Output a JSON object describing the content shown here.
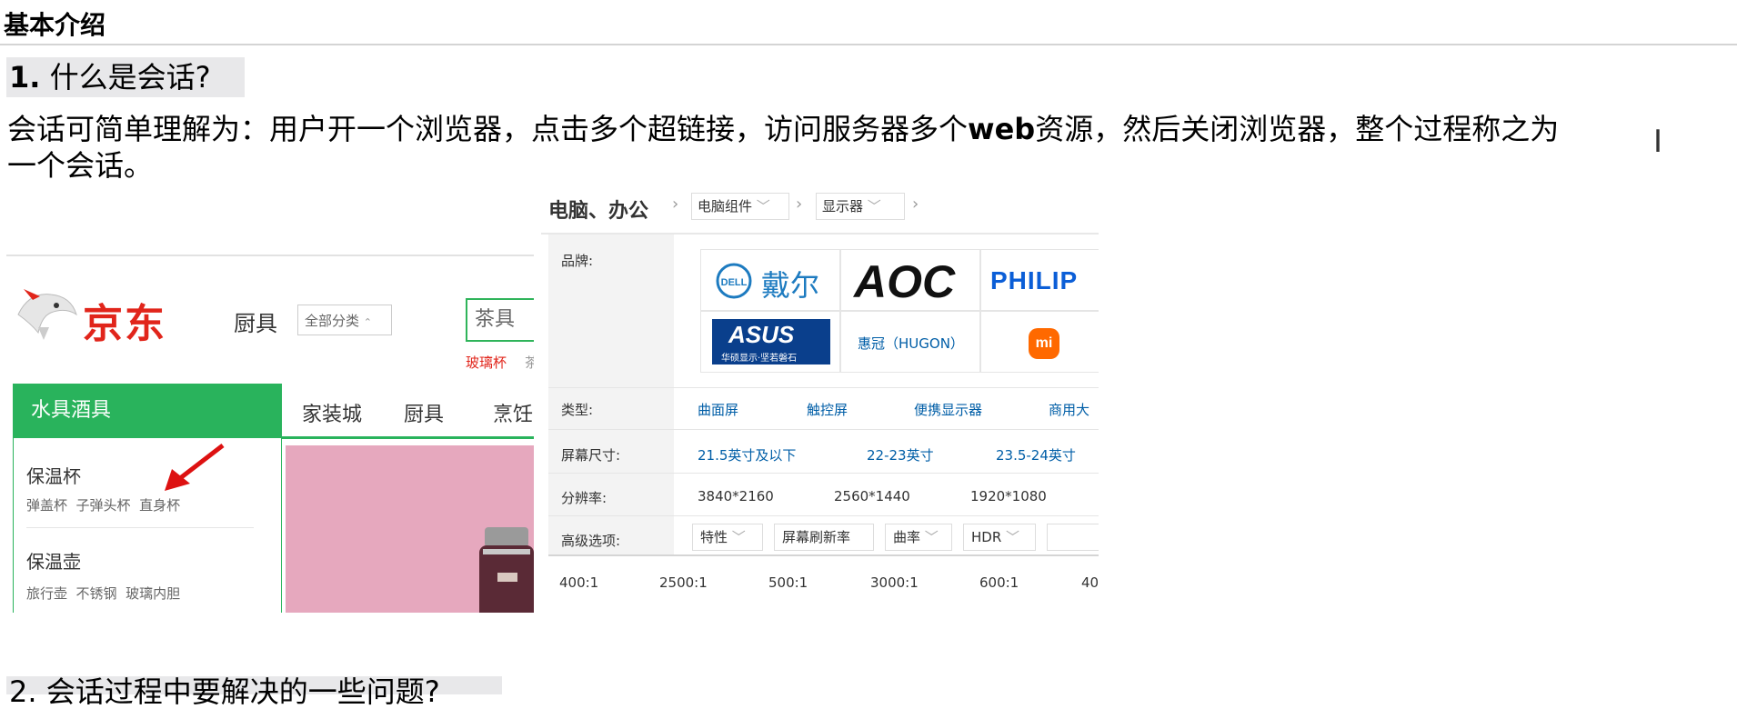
{
  "doc": {
    "title": "基本介绍",
    "h1_num": "1.",
    "h1_text": "什么是会话?",
    "para_a": "会话可简单理解为：用户开一个浏览器，点击多个超链接，访问服务器多个",
    "para_bold": "web",
    "para_b": "资源，然后关闭浏览器，整个过程称之为",
    "para_c": "一个会话。",
    "h2_text": "2. 会话过程中要解决的一些问题?"
  },
  "jd": {
    "logo": "京东",
    "kitchen": "厨具",
    "category": "全部分类",
    "search_value": "茶具",
    "hot_words": [
      "玻璃杯",
      "茶"
    ],
    "side_active": "水具酒具",
    "nav": [
      "家装城",
      "厨具",
      "烹饪"
    ],
    "groups": [
      {
        "title": "保温杯",
        "links": "弹盖杯  子弹头杯  直身杯"
      },
      {
        "title": "保温壶",
        "links": "旅行壶  不锈钢  玻璃内胆"
      }
    ]
  },
  "filter": {
    "crumb_title": "电脑、办公",
    "crumb1": "电脑组件",
    "crumb2": "显示器",
    "labels": {
      "brand": "品牌:",
      "type": "类型:",
      "size": "屏幕尺寸:",
      "resolution": "分辨率:",
      "advanced": "高级选项:"
    },
    "brands": {
      "dell": "戴尔",
      "dell_badge": "DELL",
      "aoc": "AOC",
      "philips": "PHILIP",
      "asus": "ASUS",
      "asus_sub": "华硕显示·坚若磐石",
      "hugon": "惠冠（HUGON）",
      "mi": "mi"
    },
    "types": [
      "曲面屏",
      "触控屏",
      "便携显示器",
      "商用大"
    ],
    "sizes": [
      "21.5英寸及以下",
      "22-23英寸",
      "23.5-24英寸"
    ],
    "resolutions": [
      "3840*2160",
      "2560*1440",
      "1920*1080"
    ],
    "advanced": [
      "特性",
      "屏幕刷新率",
      "曲率",
      "HDR"
    ],
    "ratios": [
      "400:1",
      "2500:1",
      "500:1",
      "3000:1",
      "600:1",
      "40"
    ]
  }
}
